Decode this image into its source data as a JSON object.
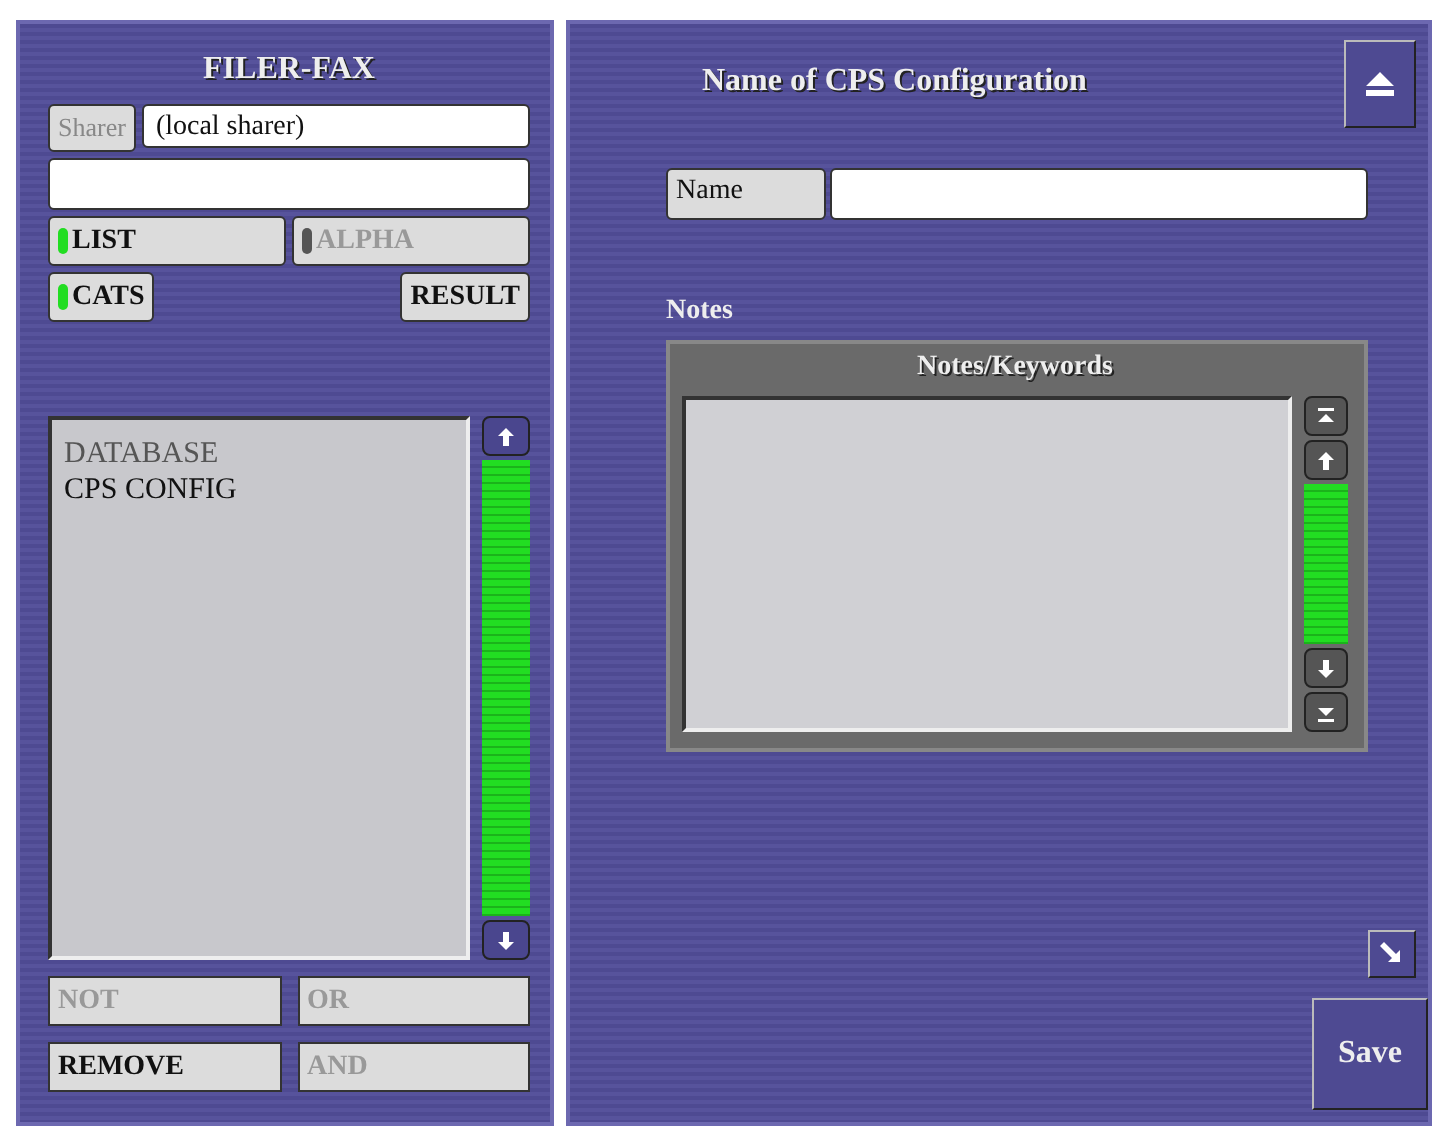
{
  "filer_fax": {
    "title": "FILER-FAX",
    "sharer": {
      "label": "Sharer",
      "disabled": true,
      "value": "(local sharer)"
    },
    "toggles": [
      {
        "label": "LIST",
        "on": true
      },
      {
        "label": "ALPHA",
        "on": false
      },
      {
        "label": "CATS",
        "on": true
      }
    ],
    "result_button": "RESULT",
    "list_items": [
      {
        "label": "DATABASE",
        "disabled": true
      },
      {
        "label": "CPS CONFIG",
        "disabled": false
      }
    ],
    "buttons": [
      {
        "label": "NOT",
        "disabled": true
      },
      {
        "label": "OR",
        "disabled": true
      },
      {
        "label": "REMOVE",
        "disabled": false
      },
      {
        "label": "AND",
        "disabled": true
      }
    ]
  },
  "config": {
    "title": "Name of CPS Configuration",
    "name_label": "Name",
    "notes_label": "Notes",
    "notes_title": "Notes/Keywords",
    "save_button": "Save"
  }
}
